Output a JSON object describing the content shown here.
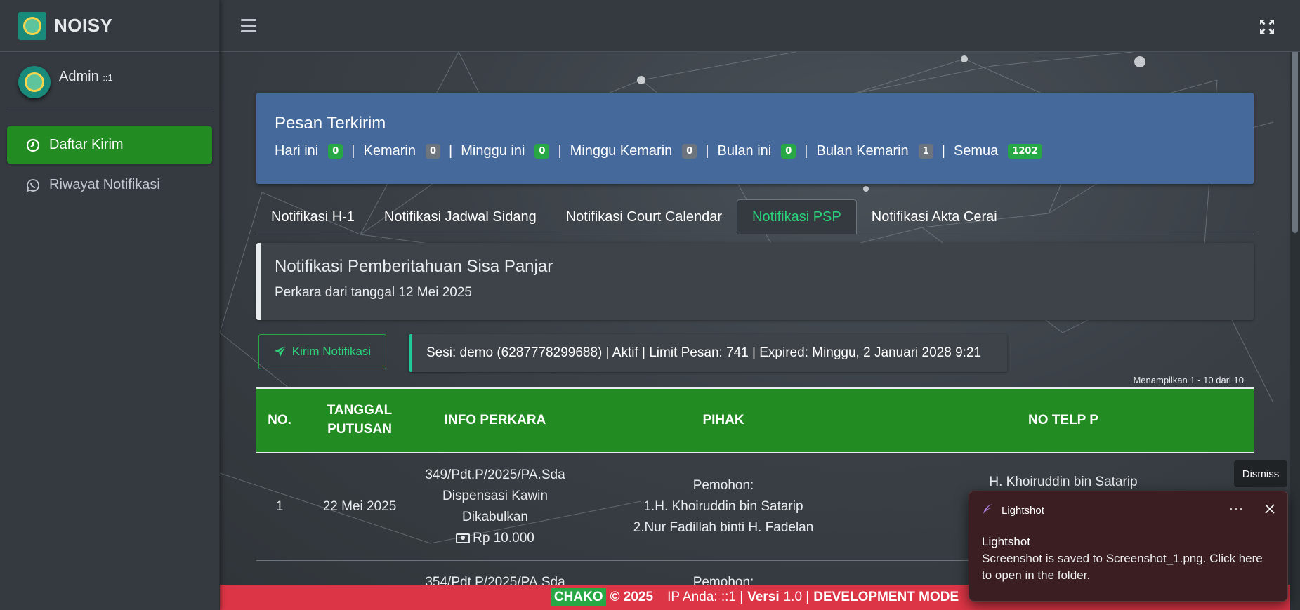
{
  "brand": {
    "name": "NOISY"
  },
  "user": {
    "name": "Admin",
    "ip": "::1"
  },
  "sidebar": {
    "items": [
      {
        "label": "Daftar Kirim",
        "icon": "clock-icon",
        "active": true
      },
      {
        "label": "Riwayat Notifikasi",
        "icon": "whatsapp-icon",
        "active": false
      }
    ]
  },
  "hero": {
    "title": "Pesan Terkirim",
    "stats": [
      {
        "label": "Hari ini",
        "value": "0",
        "color": "green"
      },
      {
        "label": "Kemarin",
        "value": "0",
        "color": "gray"
      },
      {
        "label": "Minggu ini",
        "value": "0",
        "color": "green"
      },
      {
        "label": "Minggu Kemarin",
        "value": "0",
        "color": "gray"
      },
      {
        "label": "Bulan ini",
        "value": "0",
        "color": "green"
      },
      {
        "label": "Bulan Kemarin",
        "value": "1",
        "color": "gray"
      },
      {
        "label": "Semua",
        "value": "1202",
        "color": "green"
      }
    ],
    "separator": "|"
  },
  "tabs": [
    {
      "label": "Notifikasi H-1",
      "active": false
    },
    {
      "label": "Notifikasi Jadwal Sidang",
      "active": false
    },
    {
      "label": "Notifikasi Court Calendar",
      "active": false
    },
    {
      "label": "Notifikasi PSP",
      "active": true
    },
    {
      "label": "Notifikasi Akta Cerai",
      "active": false
    }
  ],
  "callout": {
    "title": "Notifikasi Pemberitahuan Sisa Panjar",
    "subtitle": "Perkara dari tanggal 12 Mei 2025"
  },
  "actions": {
    "send_label": "Kirim Notifikasi"
  },
  "session": {
    "text": "Sesi: demo (6287778299688) | Aktif | Limit Pesan: 741 | Expired: Minggu, 2 Januari 2028 9:21"
  },
  "table": {
    "showing": "Menampilkan 1 - 10 dari 10",
    "headers": [
      "NO.",
      "TANGGAL PUTUSAN",
      "INFO PERKARA",
      "PIHAK",
      "NO TELP P"
    ],
    "rows": [
      {
        "no": "1",
        "tanggal": "22 Mei 2025",
        "perkara": "349/Pdt.P/2025/PA.Sda",
        "jenis": "Dispensasi Kawin",
        "status": "Dikabulkan",
        "sisa": "Rp 10.000",
        "pihak_label": "Pemohon:",
        "pihak_1": "1.H. Khoiruddin bin Satarip",
        "pihak_2": "2.Nur Fadillah binti H. Fadelan",
        "telp": "H. Khoiruddin bin Satarip"
      },
      {
        "no": "",
        "tanggal": "",
        "perkara": "354/Pdt.P/2025/PA.Sda",
        "pihak_label": "Pemohon:"
      }
    ]
  },
  "footer": {
    "brand": "CHAKO",
    "copyright": "© 2025",
    "ip_label": "IP Anda: ::1 |",
    "version_label": "Versi",
    "version": "1.0 |",
    "mode": "DEVELOPMENT MODE"
  },
  "notification": {
    "dismiss_label": "Dismiss",
    "app": "Lightshot",
    "more": "···",
    "title": "Lightshot",
    "message": "Screenshot is saved to Screenshot_1.png. Click here to open in the folder."
  }
}
